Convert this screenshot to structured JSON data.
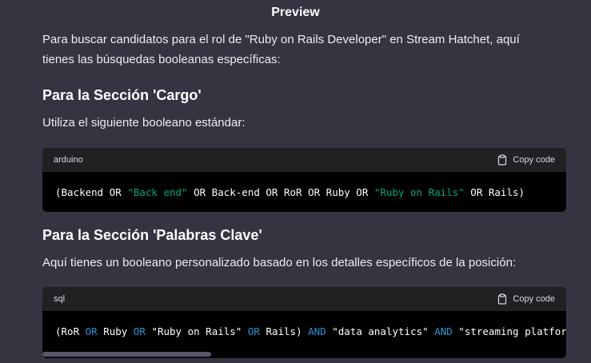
{
  "header": {
    "title": "Preview"
  },
  "intro": "Para buscar candidatos para el rol de \"Ruby on Rails Developer\" en Stream Hatchet, aquí tienes las búsquedas booleanas específicas:",
  "section1": {
    "heading": "Para la Sección 'Cargo'",
    "text": "Utiliza el siguiente booleano estándar:",
    "code": {
      "language": "arduino",
      "copy_label": "Copy code",
      "tokens": [
        {
          "t": "(Backend OR ",
          "c": "plain"
        },
        {
          "t": "\"Back end\"",
          "c": "str"
        },
        {
          "t": " OR Back-end OR RoR OR Ruby OR ",
          "c": "plain"
        },
        {
          "t": "\"Ruby on Rails\"",
          "c": "str"
        },
        {
          "t": " OR Rails)",
          "c": "plain"
        }
      ]
    }
  },
  "section2": {
    "heading": "Para la Sección 'Palabras Clave'",
    "text": "Aquí tienes un booleano personalizado basado en los detalles específicos de la posición:",
    "code": {
      "language": "sql",
      "copy_label": "Copy code",
      "tokens": [
        {
          "t": "(RoR ",
          "c": "plain"
        },
        {
          "t": "OR",
          "c": "kw"
        },
        {
          "t": " Ruby ",
          "c": "plain"
        },
        {
          "t": "OR",
          "c": "kw"
        },
        {
          "t": " \"Ruby on Rails\" ",
          "c": "plain"
        },
        {
          "t": "OR",
          "c": "kw"
        },
        {
          "t": " Rails) ",
          "c": "plain"
        },
        {
          "t": "AND",
          "c": "kw"
        },
        {
          "t": " \"data analytics\" ",
          "c": "plain"
        },
        {
          "t": "AND",
          "c": "kw"
        },
        {
          "t": " \"streaming platfor",
          "c": "plain"
        }
      ]
    }
  },
  "colors": {
    "background": "#343541",
    "code_bg": "#000000",
    "code_header": "#202123",
    "string": "#00a67d",
    "keyword": "#2e95d3"
  },
  "icons": {
    "copy": "clipboard-icon"
  }
}
